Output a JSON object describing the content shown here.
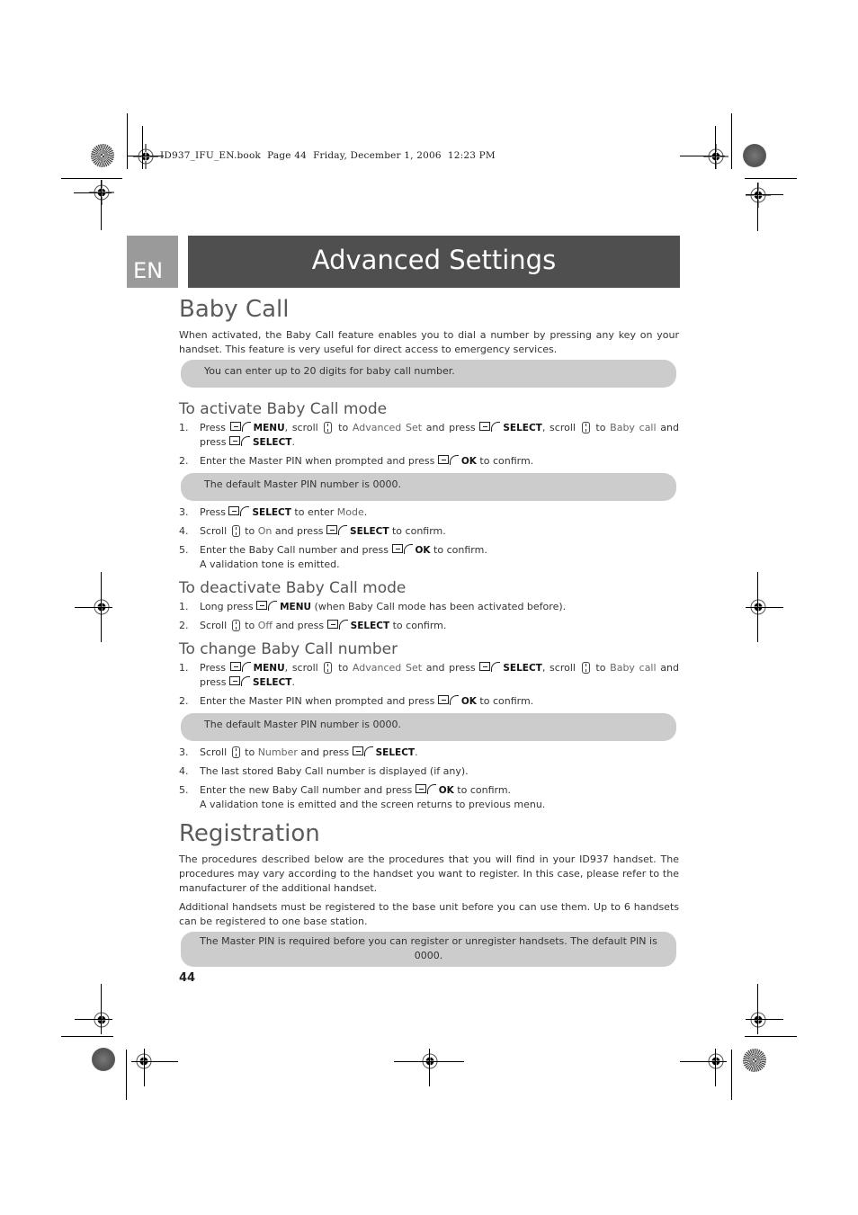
{
  "print_meta": "ID937_IFU_EN.book  Page 44  Friday, December 1, 2006  12:23 PM",
  "header": {
    "lang": "EN",
    "title": "Advanced Settings"
  },
  "baby_call": {
    "title": "Baby Call",
    "intro": "When activated, the Baby Call feature enables you to dial a number by pressing any key on your handset. This feature is very useful for direct access to emergency services.",
    "note": "You can enter up to 20 digits for baby call number."
  },
  "activate": {
    "title": "To activate Baby Call mode",
    "steps": [
      {
        "num": "1.",
        "parts": [
          "Press ",
          "MENU",
          ", scroll ",
          " to ",
          "Advanced Set",
          " and press ",
          "SELECT",
          ", scroll ",
          " to ",
          "Baby call",
          " and press ",
          "SELECT",
          "."
        ]
      },
      {
        "num": "2.",
        "parts": [
          "Enter the Master PIN when prompted and press ",
          "OK",
          " to confirm."
        ]
      }
    ],
    "note": "The default Master PIN number is 0000.",
    "steps2": [
      {
        "num": "3.",
        "parts": [
          "Press ",
          "SELECT",
          " to enter ",
          "Mode",
          "."
        ]
      },
      {
        "num": "4.",
        "parts": [
          "Scroll ",
          " to ",
          "On",
          " and press ",
          "SELECT",
          " to confirm."
        ]
      },
      {
        "num": "5.",
        "parts": [
          "Enter the Baby Call number and press ",
          "OK",
          " to confirm."
        ],
        "extra": "A validation tone is emitted."
      }
    ]
  },
  "deactivate": {
    "title": "To deactivate Baby Call mode",
    "steps": [
      {
        "num": "1.",
        "parts": [
          "Long press ",
          "MENU",
          " (when Baby Call mode has been activated before)."
        ]
      },
      {
        "num": "2.",
        "parts": [
          "Scroll ",
          " to ",
          "Off",
          " and press ",
          "SELECT",
          " to confirm."
        ]
      }
    ]
  },
  "change": {
    "title": "To change Baby Call number",
    "steps": [
      {
        "num": "1.",
        "parts": [
          "Press ",
          "MENU",
          ", scroll ",
          " to ",
          "Advanced Set",
          " and press ",
          "SELECT",
          ", scroll ",
          " to ",
          "Baby call",
          " and press ",
          "SELECT",
          "."
        ]
      },
      {
        "num": "2.",
        "parts": [
          "Enter the Master PIN when prompted and press ",
          "OK",
          " to confirm."
        ]
      }
    ],
    "note": "The default Master PIN number is 0000.",
    "steps2": [
      {
        "num": "3.",
        "parts": [
          "Scroll ",
          " to ",
          "Number",
          " and press ",
          "SELECT",
          "."
        ]
      },
      {
        "num": "4.",
        "parts": [
          "The last stored Baby Call number is displayed (if any)."
        ]
      },
      {
        "num": "5.",
        "parts": [
          "Enter the new Baby Call number and press ",
          "OK",
          " to confirm."
        ],
        "extra": "A validation tone is emitted and the screen returns to previous menu."
      }
    ]
  },
  "registration": {
    "title": "Registration",
    "para1": "The procedures described below are the procedures that you will find in your ID937 handset. The procedures may vary according to the handset you want to register. In this case, please refer to the manufacturer of the additional handset.",
    "para2": "Additional handsets must be registered to the base unit before you can use them. Up to 6 handsets can be registered to one base station.",
    "note": "The Master PIN is required before you can register or unregister handsets. The default PIN is 0000."
  },
  "page_number": "44"
}
